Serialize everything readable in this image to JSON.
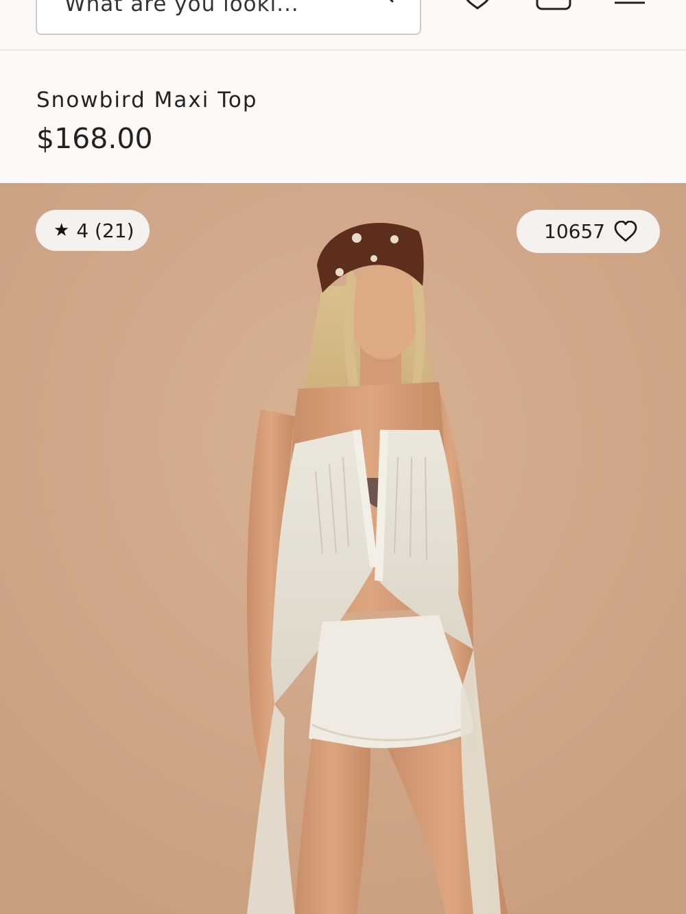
{
  "header": {
    "search_text": "What are you looki...",
    "icons": [
      "search-icon",
      "heart-icon",
      "bag-icon",
      "menu-icon"
    ]
  },
  "product": {
    "title": "Snowbird Maxi Top",
    "price": "$168.00"
  },
  "image_overlay": {
    "rating": "4 (21)",
    "star": "★",
    "favorites_count": "10657"
  },
  "colors": {
    "page_background": "#fdf9f7",
    "photo_background": "#d1a787",
    "pill_background": "#f5f1ee"
  }
}
